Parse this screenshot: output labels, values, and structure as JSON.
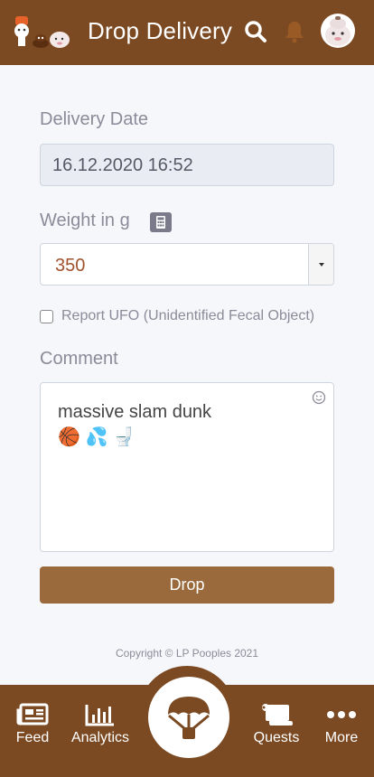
{
  "header": {
    "title": "Drop Delivery",
    "icons": [
      "logo-poop-characters",
      "search-icon",
      "bell-icon",
      "avatar"
    ]
  },
  "form": {
    "delivery_date_label": "Delivery Date",
    "delivery_date_value": "16.12.2020 16:52",
    "weight_label": "Weight in g",
    "weight_value": "350",
    "ufo_label": "Report UFO (Unidentified Fecal Object)",
    "ufo_checked": false,
    "comment_label": "Comment",
    "comment_value": "massive slam dunk\n🏀 💦 🚽",
    "submit_label": "Drop"
  },
  "footer": {
    "copyright": "Copyright © LP Pooples 2021"
  },
  "bottom_nav": {
    "feed": "Feed",
    "analytics": "Analytics",
    "quests": "Quests",
    "more": "More",
    "center_icon": "parachute-icon"
  },
  "colors": {
    "brand_brown": "#7b4a22",
    "button_brown": "#9a6a3c",
    "label_gray": "#8b8b99"
  }
}
